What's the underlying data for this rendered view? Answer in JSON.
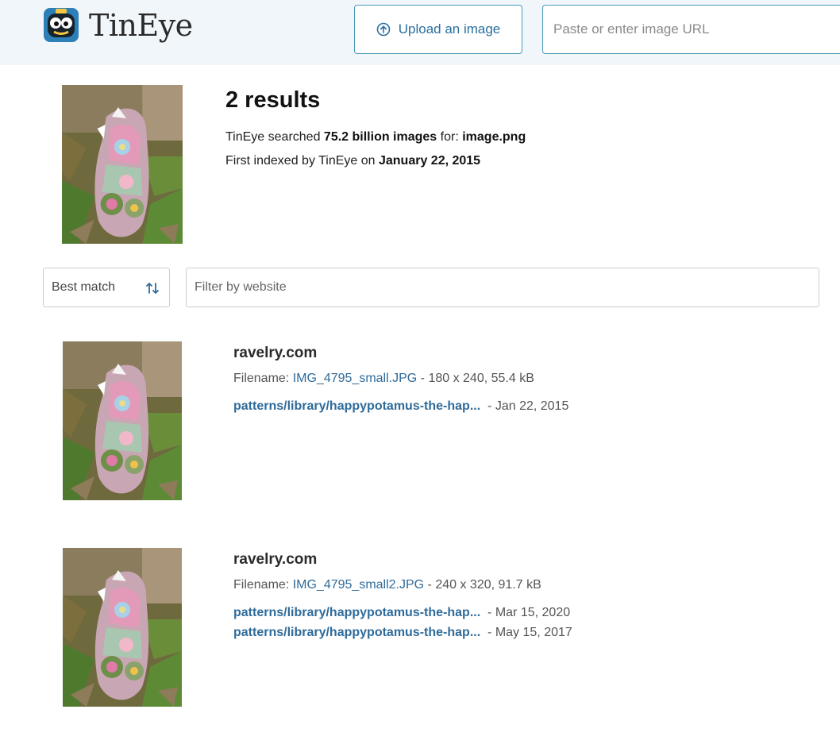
{
  "header": {
    "logo_text": "TinEye",
    "upload_label": "Upload an image",
    "url_placeholder": "Paste or enter image URL"
  },
  "summary": {
    "results_title": "2 results",
    "searched_prefix": "TinEye searched ",
    "searched_count": "75.2 billion images",
    "searched_middle": " for: ",
    "searched_file": "image.png",
    "indexed_prefix": "First indexed by TinEye on ",
    "indexed_date": "January 22, 2015"
  },
  "controls": {
    "sort_label": "Best match",
    "filter_placeholder": "Filter by website"
  },
  "results": [
    {
      "domain": "ravelry.com",
      "filename_label": "Filename: ",
      "filename": "IMG_4795_small.JPG",
      "file_meta": " - 180 x 240, 55.4 kB",
      "matches": [
        {
          "path": "patterns/library/happypotamus-the-hap...",
          "date": " - Jan 22, 2015"
        }
      ]
    },
    {
      "domain": "ravelry.com",
      "filename_label": "Filename: ",
      "filename": "IMG_4795_small2.JPG",
      "file_meta": " - 240 x 320, 91.7 kB",
      "matches": [
        {
          "path": "patterns/library/happypotamus-the-hap...",
          "date": " - Mar 15, 2020"
        },
        {
          "path": "patterns/library/happypotamus-the-hap...",
          "date": " - May 15, 2017"
        }
      ]
    }
  ],
  "colors": {
    "header_bg": "#f1f6fb",
    "accent": "#2f6b9a",
    "border": "#4a9bb8"
  }
}
